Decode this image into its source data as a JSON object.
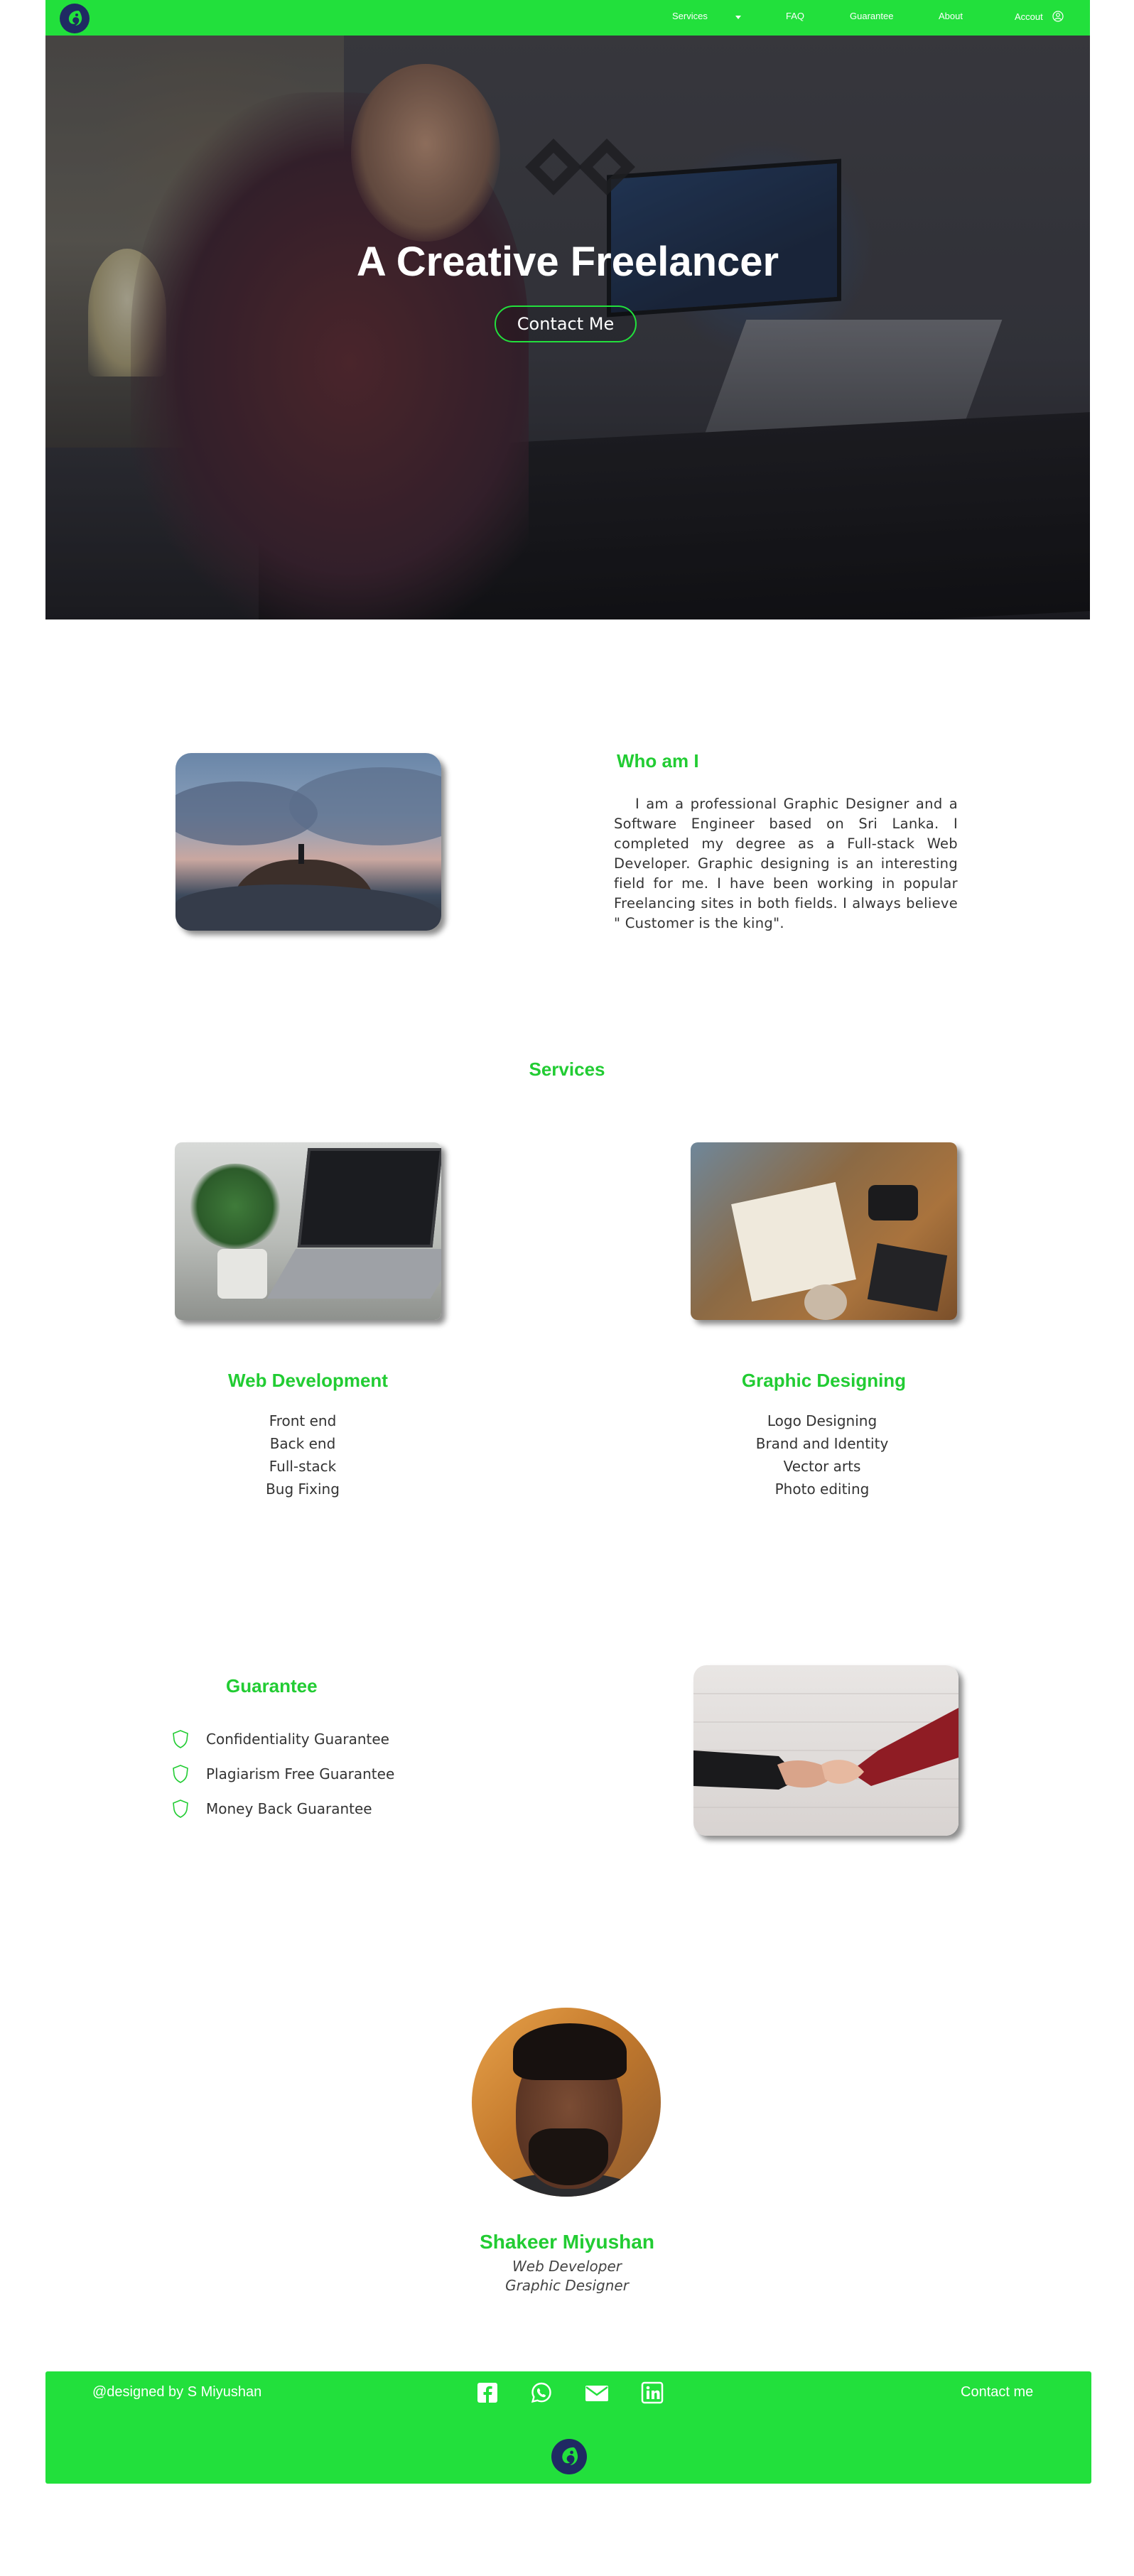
{
  "nav": {
    "services": "Services",
    "faq": "FAQ",
    "guarantee": "Guarantee",
    "about": "About",
    "account": "Accout"
  },
  "hero": {
    "title": "A Creative Freelancer",
    "button": "Contact Me"
  },
  "about": {
    "title": "Who am I",
    "text": "I am a professional Graphic Designer and a Software Engineer based on Sri Lanka. I completed my degree as a Full-stack Web Developer. Graphic designing is an interesting field for me. I have been working in popular Freelancing sites in both fields. I always believe \" Customer is the king\"."
  },
  "services": {
    "title": "Services",
    "web": {
      "title": "Web Development",
      "items": [
        "Front end",
        "Back end",
        "Full-stack",
        "Bug Fixing"
      ]
    },
    "graphic": {
      "title": "Graphic Designing",
      "items": [
        "Logo Designing",
        "Brand and Identity",
        "Vector arts",
        "Photo editing"
      ]
    }
  },
  "guarantee": {
    "title": "Guarantee",
    "items": [
      "Confidentiality Guarantee",
      "Plagiarism Free Guarantee",
      "Money Back Guarantee"
    ]
  },
  "profile": {
    "name": "Shakeer Miyushan",
    "role1": "Web Developer",
    "role2": "Graphic Designer"
  },
  "footer": {
    "credit": "@designed by S Miyushan",
    "contact": "Contact me",
    "social": [
      "facebook-icon",
      "whatsapp-icon",
      "email-icon",
      "linkedin-icon"
    ]
  },
  "colors": {
    "accent": "#22e03c",
    "heading": "#22cc33",
    "logo": "#1f2a63"
  }
}
